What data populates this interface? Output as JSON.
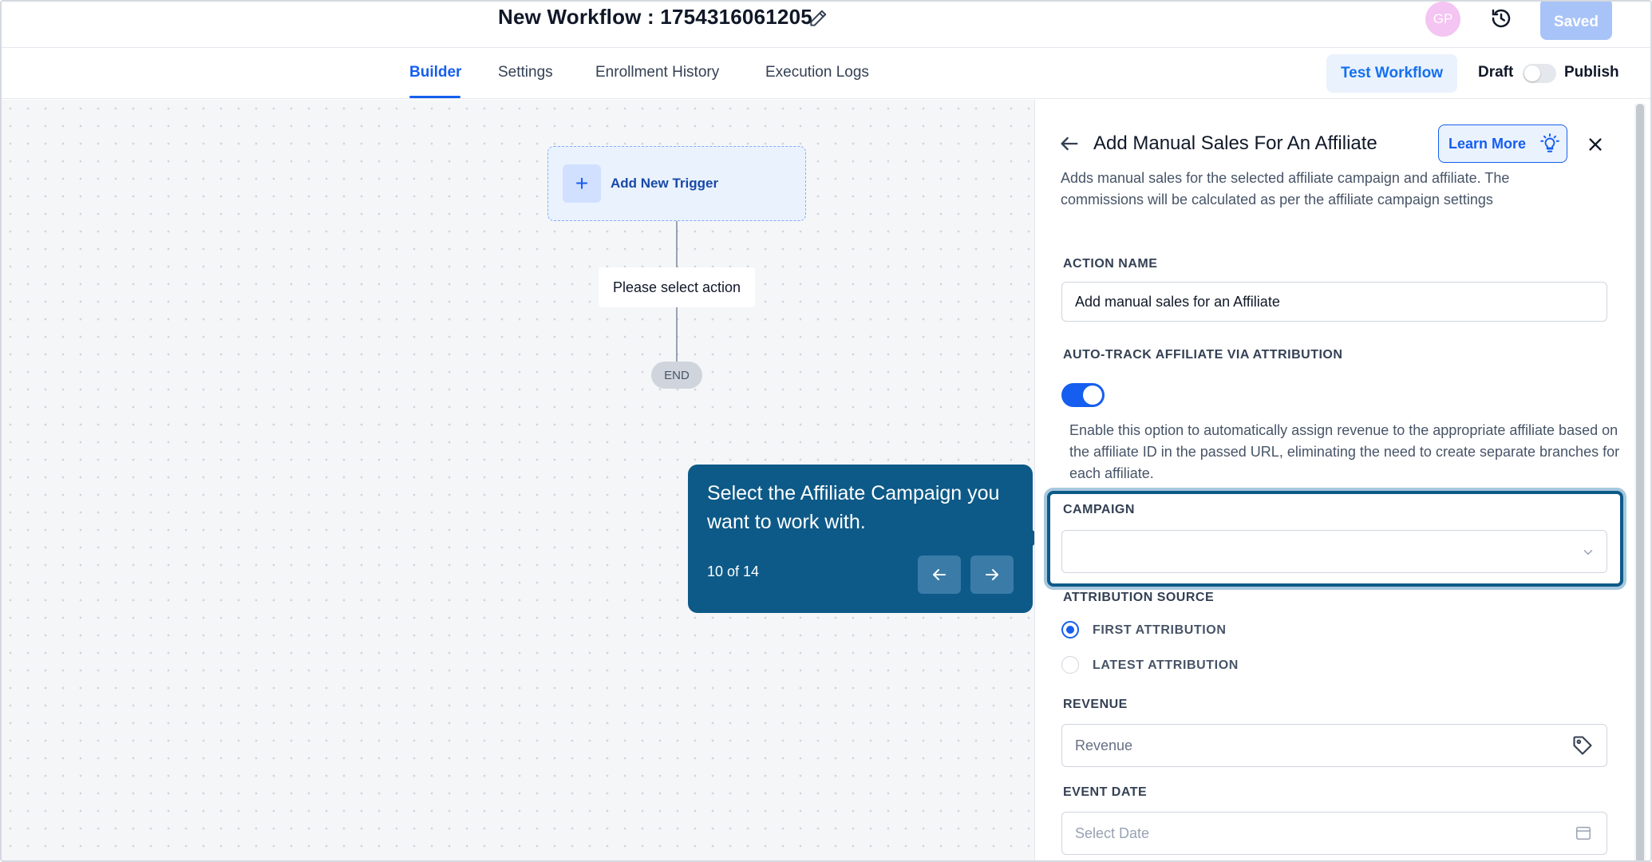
{
  "header": {
    "workflow_title": "New Workflow : 1754316061205",
    "avatar_initials": "GP",
    "saved_label": "Saved",
    "icons": [
      "edit-icon",
      "history-icon"
    ]
  },
  "tabs": [
    {
      "label": "Builder",
      "active": true
    },
    {
      "label": "Settings",
      "active": false
    },
    {
      "label": "Enrollment History",
      "active": false
    },
    {
      "label": "Execution Logs",
      "active": false
    }
  ],
  "toolbar": {
    "test_label": "Test Workflow",
    "draft_label": "Draft",
    "publish_label": "Publish",
    "publish_enabled": false
  },
  "canvas": {
    "trigger_label": "Add New Trigger",
    "action_placeholder": "Please select action",
    "end_label": "END"
  },
  "tooltip": {
    "text": "Select the Affiliate Campaign you want to work with.",
    "step_counter": "10 of 14",
    "icons": [
      "arrow-left-icon",
      "arrow-right-icon"
    ]
  },
  "panel": {
    "title": "Add Manual Sales For An Affiliate",
    "learn_more_label": "Learn More",
    "description": "Adds manual sales for the selected affiliate campaign and affiliate. The commissions will be calculated as per the affiliate campaign settings",
    "action_name": {
      "label": "ACTION NAME",
      "value": "Add manual sales for an Affiliate"
    },
    "auto_track": {
      "label": "AUTO-TRACK AFFILIATE VIA ATTRIBUTION",
      "enabled": true,
      "help": "Enable this option to automatically assign revenue to the appropriate affiliate based on the affiliate ID in the passed URL, eliminating the need to create separate branches for each affiliate."
    },
    "campaign": {
      "label": "CAMPAIGN",
      "value": ""
    },
    "attribution_source": {
      "label": "ATTRIBUTION SOURCE",
      "options": [
        {
          "label": "FIRST ATTRIBUTION",
          "selected": true
        },
        {
          "label": "LATEST ATTRIBUTION",
          "selected": false
        }
      ]
    },
    "revenue": {
      "label": "REVENUE",
      "placeholder": "Revenue"
    },
    "event_date": {
      "label": "EVENT DATE",
      "placeholder": "Select Date"
    }
  },
  "colors": {
    "primary": "#155eef",
    "tooltip_bg": "#0d5a88",
    "saved_bg": "#a8c3f7"
  }
}
